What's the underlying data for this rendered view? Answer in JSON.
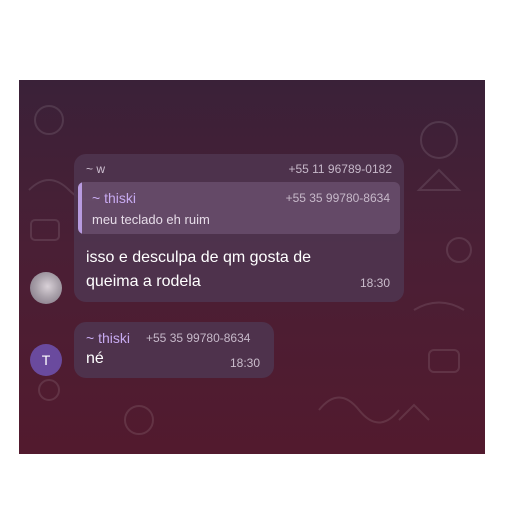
{
  "messages": [
    {
      "sender_name": "~ w",
      "sender_phone": "+55 11 96789-0182",
      "quoted": {
        "name": "~ thiski",
        "phone": "+55 35 99780-8634",
        "text": "meu teclado eh ruim"
      },
      "text": "isso e desculpa de qm gosta de queima a rodela",
      "time": "18:30"
    },
    {
      "sender_name": "~ thiski",
      "sender_phone": "+55 35 99780-8634",
      "avatar_initial": "T",
      "text": "né",
      "time": "18:30"
    }
  ],
  "colors": {
    "background_top": "#3a2138",
    "background_bottom": "#521a2e",
    "bubble": "#4e344e",
    "name_accent": "#c7aaf0",
    "quote_bar": "#b89be0",
    "avatar": "#6a4a9e"
  }
}
